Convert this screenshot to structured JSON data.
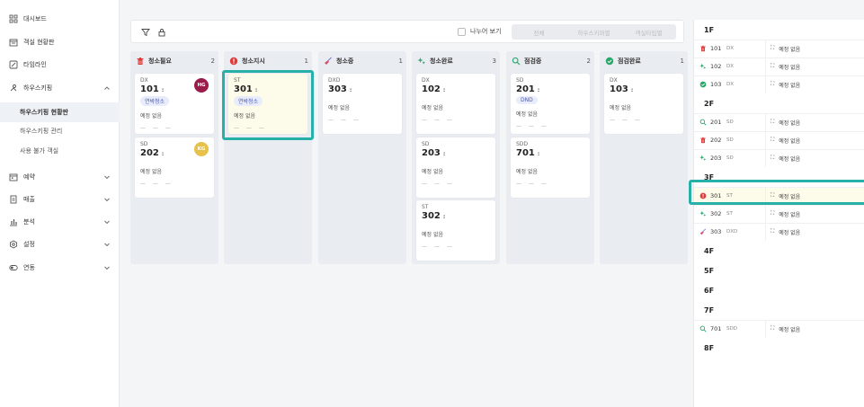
{
  "sidebar": {
    "items": [
      {
        "label": "대시보드",
        "icon": "grid-icon"
      },
      {
        "label": "객실 현황판",
        "icon": "calendar-board-icon"
      },
      {
        "label": "타임라인",
        "icon": "timeline-icon"
      },
      {
        "label": "하우스키핑",
        "icon": "cleaning-icon"
      }
    ],
    "subitems": [
      {
        "label": "하우스키핑 현황판",
        "active": true
      },
      {
        "label": "하우스키핑 관리",
        "active": false
      },
      {
        "label": "사용 불가 객실",
        "active": false
      }
    ],
    "groups": [
      {
        "label": "예약",
        "icon": "calendar-icon"
      },
      {
        "label": "매출",
        "icon": "receipt-icon"
      },
      {
        "label": "분석",
        "icon": "bar-chart-icon"
      },
      {
        "label": "설정",
        "icon": "gear-icon"
      },
      {
        "label": "연동",
        "icon": "toggle-icon"
      }
    ]
  },
  "toolbar": {
    "split_label": "나누어 보기",
    "segments": [
      "전체",
      "하우스키퍼별",
      "객실타입별"
    ]
  },
  "columns": [
    {
      "title": "청소필요",
      "count": "2",
      "icon": "trash-icon",
      "color": "#e03b3b",
      "cards": [
        {
          "type": "DX",
          "room": "101",
          "badge": "연박청소",
          "avatar": "HG",
          "avatar_color": "#9b1b4b",
          "sched": "예정 없음",
          "dash": "— — —"
        },
        {
          "type": "SD",
          "room": "202",
          "avatar": "KG",
          "avatar_color": "#e6c24a",
          "sched": "예정 없음",
          "dash": "— — —"
        }
      ]
    },
    {
      "title": "청소지시",
      "count": "1",
      "icon": "alert-icon",
      "color": "#e03b3b",
      "cards": [
        {
          "type": "ST",
          "room": "301",
          "badge": "연박청소",
          "sched": "예정 없음",
          "dash": "— — —",
          "highlight": true
        }
      ]
    },
    {
      "title": "청소중",
      "count": "1",
      "icon": "broom-icon",
      "color": "#d94f74",
      "cards": [
        {
          "type": "DXD",
          "room": "303",
          "sched": "예정 없음",
          "dash": "— — —"
        }
      ]
    },
    {
      "title": "청소완료",
      "count": "3",
      "icon": "sparkle-icon",
      "color": "#2aa86a",
      "cards": [
        {
          "type": "DX",
          "room": "102",
          "sched": "예정 없음",
          "dash": "— — —"
        },
        {
          "type": "SD",
          "room": "203",
          "sched": "예정 없음",
          "dash": "— — —"
        },
        {
          "type": "ST",
          "room": "302",
          "sched": "예정 없음",
          "dash": "— — —"
        }
      ]
    },
    {
      "title": "점검중",
      "count": "2",
      "icon": "search-icon",
      "color": "#2aa86a",
      "cards": [
        {
          "type": "SD",
          "room": "201",
          "badge": "DND",
          "sched": "예정 없음",
          "dash": "— — —"
        },
        {
          "type": "SDD",
          "room": "701",
          "sched": "예정 없음",
          "dash": "— — —"
        }
      ]
    },
    {
      "title": "점검완료",
      "count": "1",
      "icon": "check-circle-icon",
      "color": "#2aa86a",
      "cards": [
        {
          "type": "DX",
          "room": "103",
          "sched": "예정 없음",
          "dash": "— — —"
        }
      ]
    }
  ],
  "dots": ":",
  "floors": [
    {
      "label": "1F",
      "rooms": [
        {
          "num": "101",
          "type": "DX",
          "icon": "trash-icon",
          "sched": "예정 없음"
        },
        {
          "num": "102",
          "type": "DX",
          "icon": "sparkle-icon",
          "sched": "예정 없음"
        },
        {
          "num": "103",
          "type": "DX",
          "icon": "check-circle-icon",
          "sched": "예정 없음"
        }
      ]
    },
    {
      "label": "2F",
      "rooms": [
        {
          "num": "201",
          "type": "SD",
          "icon": "search-icon",
          "sched": "예정 없음"
        },
        {
          "num": "202",
          "type": "SD",
          "icon": "trash-icon",
          "sched": "예정 없음"
        },
        {
          "num": "203",
          "type": "SD",
          "icon": "sparkle-icon",
          "sched": "예정 없음"
        }
      ]
    },
    {
      "label": "3F",
      "rooms": [
        {
          "num": "301",
          "type": "ST",
          "icon": "alert-icon",
          "sched": "예정 없음",
          "highlight": true
        },
        {
          "num": "302",
          "type": "ST",
          "icon": "sparkle-icon",
          "sched": "예정 없음"
        },
        {
          "num": "303",
          "type": "DXD",
          "icon": "broom-icon",
          "sched": "예정 없음"
        }
      ]
    },
    {
      "label": "4F",
      "rooms": []
    },
    {
      "label": "5F",
      "rooms": []
    },
    {
      "label": "6F",
      "rooms": []
    },
    {
      "label": "7F",
      "rooms": [
        {
          "num": "701",
          "type": "SDD",
          "icon": "search-icon",
          "sched": "예정 없음"
        }
      ]
    },
    {
      "label": "8F",
      "rooms": []
    }
  ],
  "colors": {
    "accent": "#26b0a8",
    "highlight_bg": "#fdfbea",
    "danger": "#e03b3b",
    "success": "#2aa86a"
  }
}
